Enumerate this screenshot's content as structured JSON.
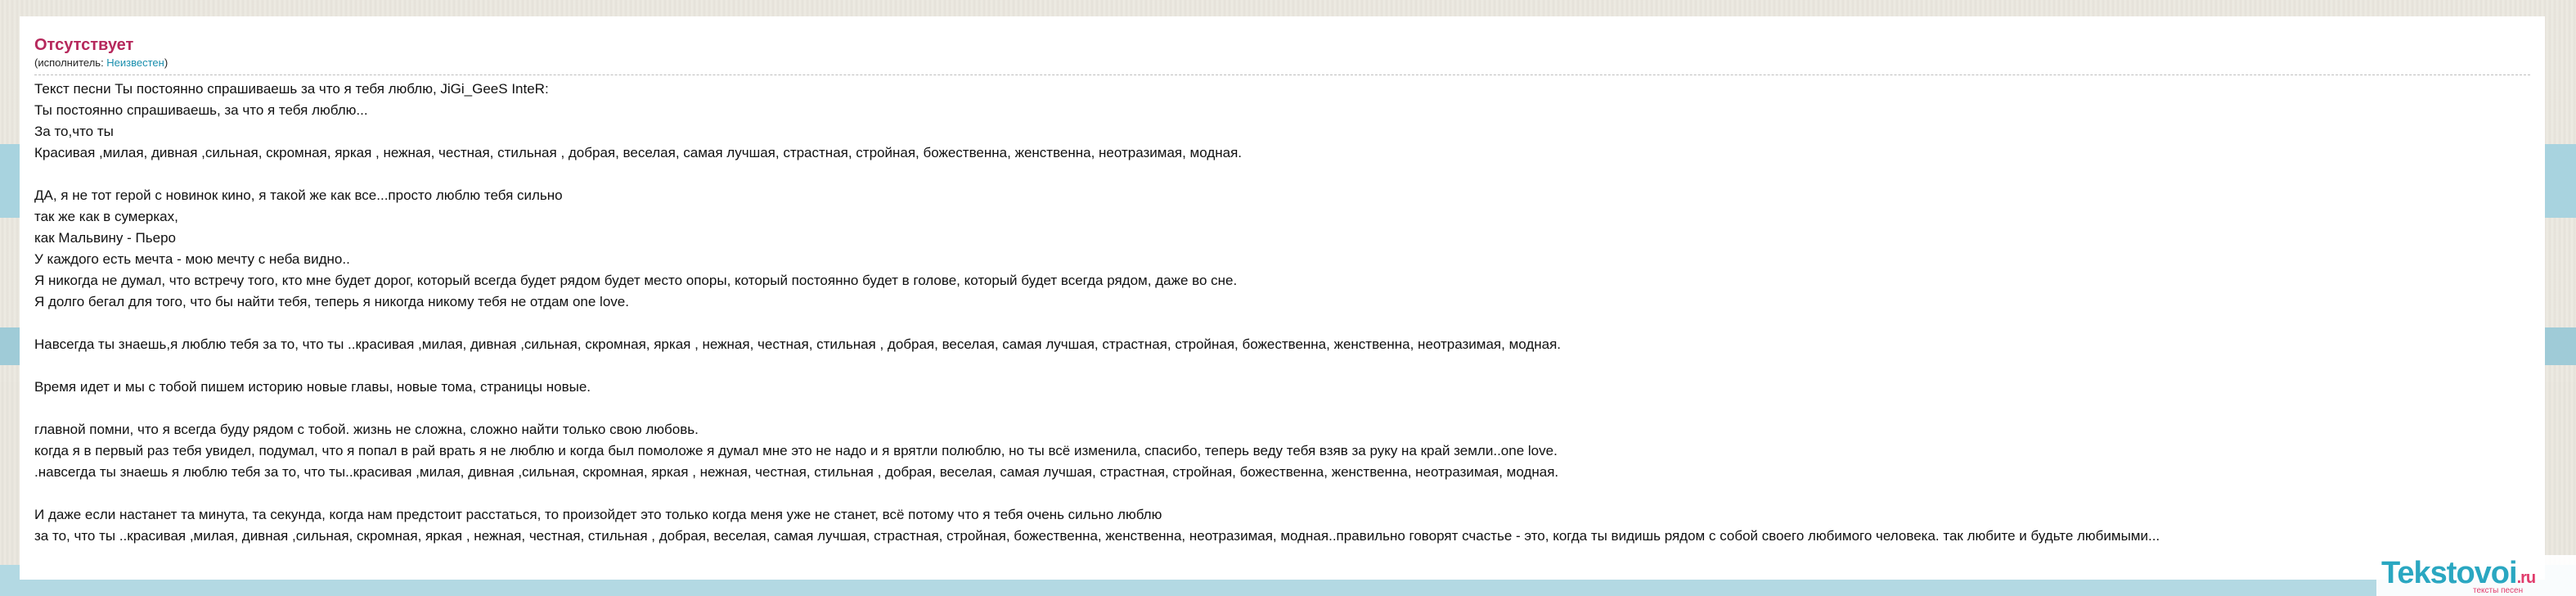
{
  "song": {
    "title": "Отсутствует",
    "artist_prefix": "(исполнитель: ",
    "artist_name": "Неизвестен",
    "artist_suffix": ")"
  },
  "lyrics": [
    "Текст песни Ты постоянно спрашиваешь за что я тебя люблю, JiGi_GeeS InteR:",
    "Ты постоянно спрашиваешь, за что я тебя люблю...",
    "За то,что ты",
    "Красивая ,милая, дивная ,сильная, скромная, яркая , нежная, честная, стильная , добрая, веселая, самая лучшая, страстная, стройная, божественна, женственна, неотразимая, модная.",
    "",
    "ДА, я не тот герой с новинок кино, я такой же как все...просто люблю тебя сильно",
    "так же как в сумерках,",
    "как Мальвину - Пьеро",
    "У каждого есть мечта - мою мечту с неба видно..",
    "Я никогда не думал, что встречу того, кто мне будет дорог, который всегда будет рядом будет место опоры, который постоянно будет в голове, который будет всегда рядом, даже во сне.",
    "Я долго бегал для того, что бы найти тебя, теперь я никогда никому тебя не отдам one love.",
    "",
    "Навсегда ты знаешь,я люблю тебя за то, что ты ..красивая ,милая, дивная ,сильная, скромная, яркая , нежная, честная, стильная , добрая, веселая, самая лучшая, страстная, стройная, божественна, женственна, неотразимая, модная.",
    "",
    "Время идет и мы с тобой пишем историю новые главы, новые тома, страницы новые.",
    "",
    "главной помни, что я всегда буду рядом с тобой. жизнь не сложна, сложно найти только свою любовь.",
    "когда я в первый раз тебя увидел, подумал, что я попал в рай врать я не люблю и когда был помоложе я думал мне это не надо и я врятли полюблю, но ты всё изменила, спасибо, теперь веду тебя взяв за руку на край земли..one love.",
    ".навсегда ты знаешь я люблю тебя за то, что ты..красивая ,милая, дивная ,сильная, скромная, яркая , нежная, честная, стильная , добрая, веселая, самая лучшая, страстная, стройная, божественна, женственна, неотразимая, модная.",
    "",
    "И даже если настанет та минута, та секунда, когда нам предстоит расстаться, то произойдет это только когда меня уже не станет, всё потому что я тебя очень сильно люблю",
    "за то, что ты ..красивая ,милая, дивная ,сильная, скромная, яркая , нежная, честная, стильная , добрая, веселая, самая лучшая, страстная, стройная, божественна, женственна, неотразимая, модная..правильно говорят счастье - это, когда ты видишь рядом с собой своего любимого человека. так любите и будьте любимыми..."
  ],
  "watermark": {
    "brand": "Tekstovoi",
    "tld": ".ru",
    "tagline": "тексты песен"
  },
  "colors": {
    "title": "#b6285c",
    "link": "#1a8fae",
    "logo": "#2aa7c1",
    "logo_accent": "#e13b6b"
  }
}
